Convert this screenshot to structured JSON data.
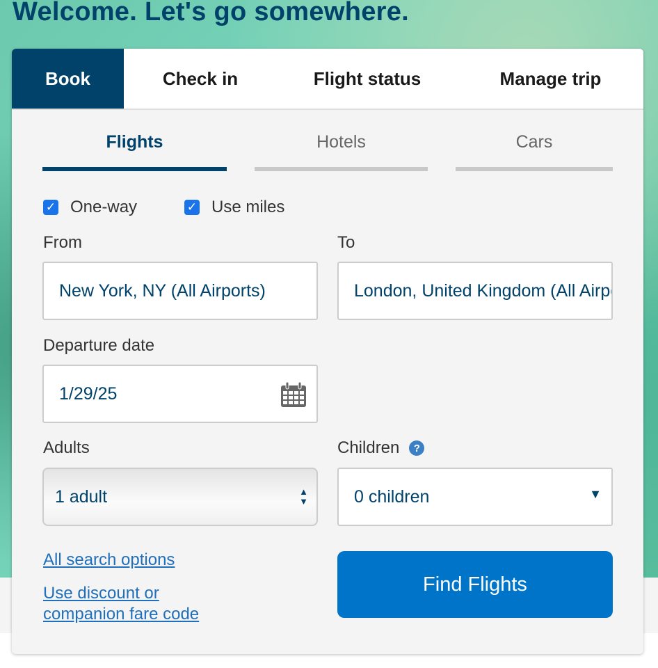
{
  "header": {
    "title": "Welcome. Let's go somewhere."
  },
  "tabs": [
    {
      "label": "Book"
    },
    {
      "label": "Check in"
    },
    {
      "label": "Flight status"
    },
    {
      "label": "Manage trip"
    }
  ],
  "subtabs": [
    {
      "label": "Flights"
    },
    {
      "label": "Hotels"
    },
    {
      "label": "Cars"
    }
  ],
  "options": {
    "one_way": "One-way",
    "use_miles": "Use miles"
  },
  "form": {
    "from_label": "From",
    "from_value": "New York, NY (All Airports)",
    "to_label": "To",
    "to_value": "London, United Kingdom (All Airports)",
    "date_label": "Departure date",
    "date_value": "1/29/25",
    "adults_label": "Adults",
    "adults_value": "1 adult",
    "children_label": "Children",
    "children_value": "0 children"
  },
  "links": {
    "all_search": "All search options",
    "discount_1": "Use discount or",
    "discount_2": "companion fare code"
  },
  "find_button": "Find Flights",
  "colors": {
    "brand": "#01426a",
    "accent": "#0074c8"
  }
}
